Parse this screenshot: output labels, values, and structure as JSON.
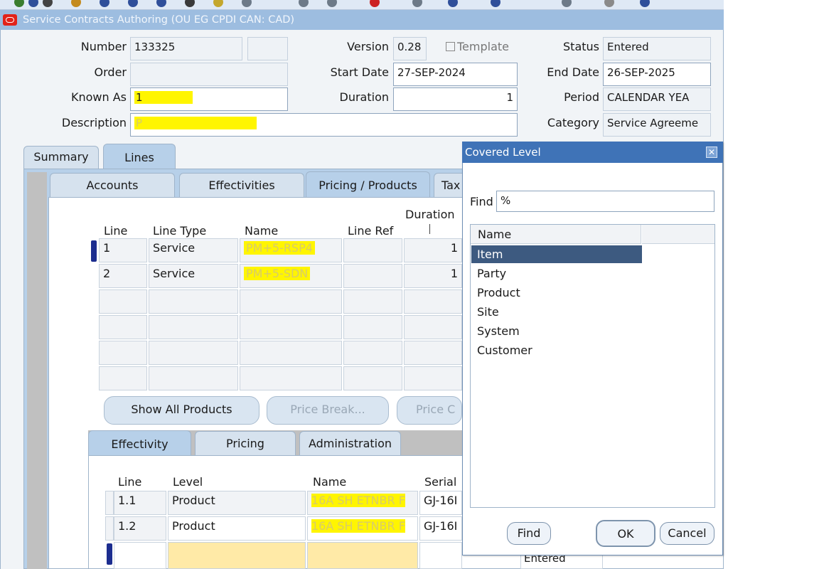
{
  "window": {
    "title": "Service Contracts Authoring (OU EG CPDI CAN: CAD)"
  },
  "header": {
    "number_label": "Number",
    "number_value": "133325",
    "version_label": "Version",
    "version_value": "0.28",
    "template_label": "Template",
    "status_label": "Status",
    "status_value": "Entered",
    "order_label": "Order",
    "order_value": "",
    "start_date_label": "Start Date",
    "start_date_value": "27-SEP-2024",
    "end_date_label": "End Date",
    "end_date_value": "26-SEP-2025",
    "known_as_label": "Known As",
    "known_as_value": "1",
    "duration_label": "Duration",
    "duration_value": "1",
    "period_label": "Period",
    "period_value": "CALENDAR YEA",
    "description_label": "Description",
    "description_value": "P",
    "category_label": "Category",
    "category_value": "Service Agreeme"
  },
  "main_tabs": [
    "Summary",
    "Lines"
  ],
  "sub_tabs": [
    "Accounts",
    "Effectivities",
    "Pricing / Products",
    "Tax"
  ],
  "lines_table": {
    "columns": {
      "line": "Line",
      "line_type": "Line Type",
      "name": "Name",
      "line_ref": "Line Ref",
      "duration": "Duration"
    },
    "rows": [
      {
        "line": "1",
        "line_type": "Service",
        "name": "PM+5-RSP4",
        "duration": "1"
      },
      {
        "line": "2",
        "line_type": "Service",
        "name": "PM+5-SDN",
        "duration": "1"
      }
    ]
  },
  "buttons": {
    "show_all_products": "Show All Products",
    "price_break": "Price Break...",
    "price_c": "Price C"
  },
  "bottom_tabs": [
    "Effectivity",
    "Pricing",
    "Administration"
  ],
  "covered_table": {
    "columns": {
      "line": "Line",
      "level": "Level",
      "name": "Name",
      "serial": "Serial"
    },
    "rows": [
      {
        "line": "1.1",
        "level": "Product",
        "name": "16A SH ETNBR F",
        "serial": "GJ-16I"
      },
      {
        "line": "1.2",
        "level": "Product",
        "name": "16A SH ETNBR F",
        "serial": "GJ-16I"
      }
    ],
    "bottom_status": "Entered"
  },
  "dialog": {
    "title": "Covered Level",
    "find_label": "Find",
    "find_value": "%",
    "list_header": "Name",
    "items": [
      "Item",
      "Party",
      "Product",
      "Site",
      "System",
      "Customer"
    ],
    "selected_index": 0,
    "find_button": "Find",
    "ok_button": "OK",
    "cancel_button": "Cancel"
  },
  "colors": {
    "accent": "#9dbde0",
    "selection": "#3d5a80",
    "highlight": "#fff500",
    "required": "#ffeaa7"
  }
}
